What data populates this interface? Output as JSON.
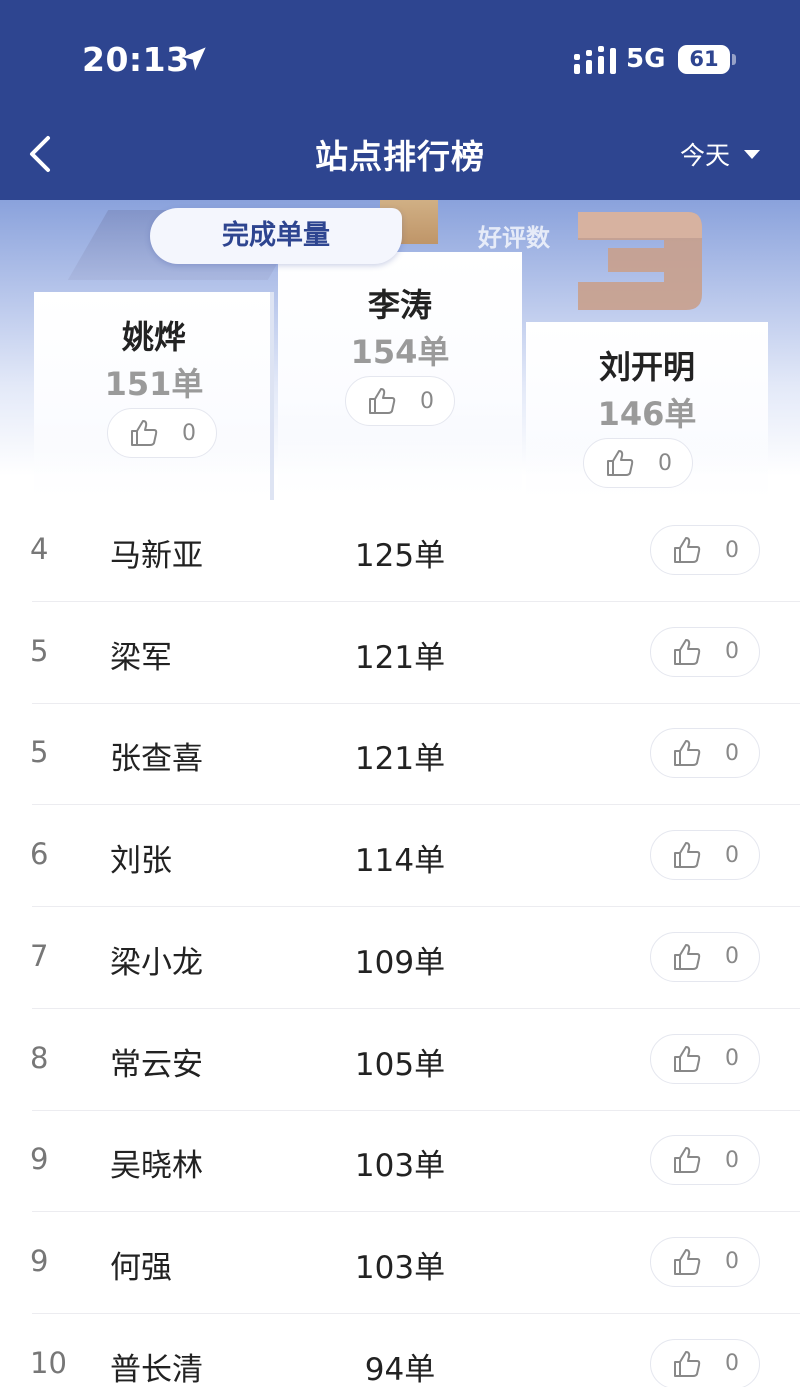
{
  "status_bar": {
    "time": "20:13",
    "network": "5G",
    "battery": "61"
  },
  "nav": {
    "title": "站点排行榜",
    "date_filter": "今天"
  },
  "tabs": {
    "active": "完成单量",
    "other": "好评数"
  },
  "podium": {
    "first": {
      "name": "李涛",
      "count": "154单",
      "likes": "0"
    },
    "second": {
      "name": "姚烨",
      "count": "151单",
      "likes": "0"
    },
    "third": {
      "name": "刘开明",
      "count": "146单",
      "likes": "0"
    }
  },
  "ranking": [
    {
      "rank": "4",
      "name": "马新亚",
      "count": "125单",
      "likes": "0"
    },
    {
      "rank": "5",
      "name": "梁军",
      "count": "121单",
      "likes": "0"
    },
    {
      "rank": "5",
      "name": "张查喜",
      "count": "121单",
      "likes": "0"
    },
    {
      "rank": "6",
      "name": "刘张",
      "count": "114单",
      "likes": "0"
    },
    {
      "rank": "7",
      "name": "梁小龙",
      "count": "109单",
      "likes": "0"
    },
    {
      "rank": "8",
      "name": "常云安",
      "count": "105单",
      "likes": "0"
    },
    {
      "rank": "9",
      "name": "吴晓林",
      "count": "103单",
      "likes": "0"
    },
    {
      "rank": "9",
      "name": "何强",
      "count": "103单",
      "likes": "0"
    },
    {
      "rank": "10",
      "name": "普长清",
      "count": "94单",
      "likes": "0"
    }
  ],
  "colors": {
    "header": "#2e4590",
    "accent": "#2e4590",
    "muted_text": "#9a9a9a"
  },
  "icons": {
    "back": "chevron-left-icon",
    "location": "location-arrow-icon",
    "signal": "signal-bars-icon",
    "battery": "battery-icon",
    "dropdown": "caret-down-icon",
    "like": "thumbs-up-icon"
  }
}
